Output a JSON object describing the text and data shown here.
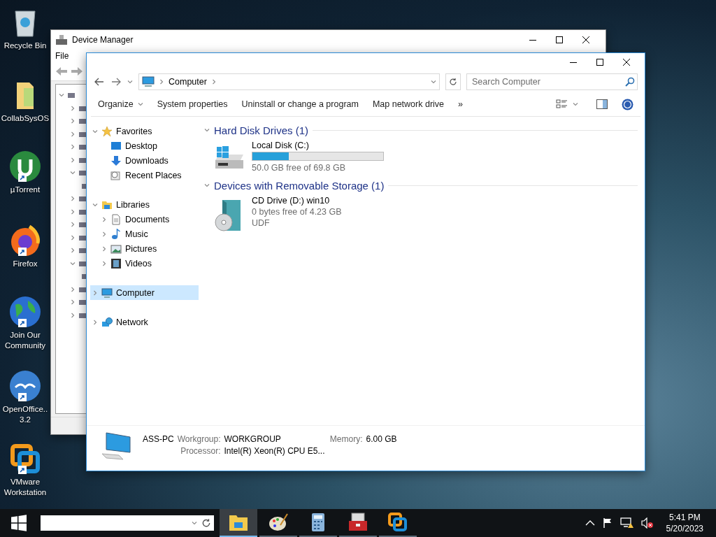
{
  "desktop_icons": [
    {
      "label": "Recycle Bin",
      "shortcut": false
    },
    {
      "label": "CollabSysOS",
      "shortcut": false
    },
    {
      "label": "µTorrent",
      "shortcut": true
    },
    {
      "label": "Firefox",
      "shortcut": true
    },
    {
      "label": "Join Our Community",
      "shortcut": true
    },
    {
      "label": "OpenOffice.. 3.2",
      "shortcut": true
    },
    {
      "label": "VMware Workstation",
      "shortcut": true
    }
  ],
  "device_manager": {
    "title": "Device Manager",
    "menu": [
      "File"
    ],
    "tree": [
      {
        "expanded": true,
        "children": [
          {
            "expanded": false
          },
          {
            "expanded": false
          },
          {
            "expanded": false
          },
          {
            "expanded": false
          },
          {
            "expanded": false
          },
          {
            "expanded": true,
            "children": [
              {
                "kind": "device"
              }
            ]
          },
          {
            "expanded": false
          },
          {
            "expanded": false
          },
          {
            "expanded": false
          },
          {
            "expanded": false
          },
          {
            "expanded": false
          },
          {
            "expanded": true,
            "children": [
              {
                "kind": "device"
              }
            ]
          },
          {
            "expanded": false
          },
          {
            "expanded": false
          },
          {
            "expanded": false
          }
        ]
      }
    ]
  },
  "explorer": {
    "breadcrumb": [
      "Computer"
    ],
    "search": {
      "placeholder": "Search Computer"
    },
    "toolbar": [
      "Organize",
      "System properties",
      "Uninstall or change a program",
      "Map network drive",
      "»"
    ],
    "navigation": [
      {
        "label": "Favorites",
        "expanded": true,
        "selected": false,
        "children": [
          {
            "label": "Desktop",
            "selected": false
          },
          {
            "label": "Downloads",
            "selected": false
          },
          {
            "label": "Recent Places",
            "selected": false
          }
        ]
      },
      {
        "label": "Libraries",
        "expanded": true,
        "selected": false,
        "children": [
          {
            "label": "Documents",
            "expanded": false,
            "selected": false
          },
          {
            "label": "Music",
            "expanded": false,
            "selected": false
          },
          {
            "label": "Pictures",
            "expanded": false,
            "selected": false
          },
          {
            "label": "Videos",
            "expanded": false,
            "selected": false
          }
        ]
      },
      {
        "label": "Computer",
        "expanded": false,
        "selected": true
      },
      {
        "label": "Network",
        "expanded": false,
        "selected": false
      }
    ],
    "groups": [
      {
        "title": "Hard Disk Drives (1)",
        "expanded": true,
        "items": [
          {
            "kind": "disk",
            "name": "Local Disk (C:)",
            "level": 0.28,
            "lines": [
              "50.0 GB free of 69.8 GB"
            ]
          }
        ]
      },
      {
        "title": "Devices with Removable Storage (1)",
        "expanded": true,
        "items": [
          {
            "kind": "cd",
            "name": "CD Drive (D:) win10",
            "lines": [
              "0 bytes free of 4.23 GB",
              "UDF"
            ]
          }
        ]
      }
    ],
    "details": {
      "name": "ASS-PC",
      "fields": [
        {
          "label": "Workgroup:",
          "value": "WORKGROUP"
        },
        {
          "label": "Memory:",
          "value": "6.00 GB"
        },
        {
          "label": "Processor:",
          "value": "Intel(R) Xeon(R) CPU E5..."
        }
      ]
    }
  },
  "taskbar": {
    "apps": [
      {
        "selected": true
      },
      {
        "selected": false
      },
      {
        "selected": false
      },
      {
        "selected": false
      },
      {
        "selected": false
      }
    ],
    "time": "5:41 PM",
    "date": "5/20/2023"
  }
}
